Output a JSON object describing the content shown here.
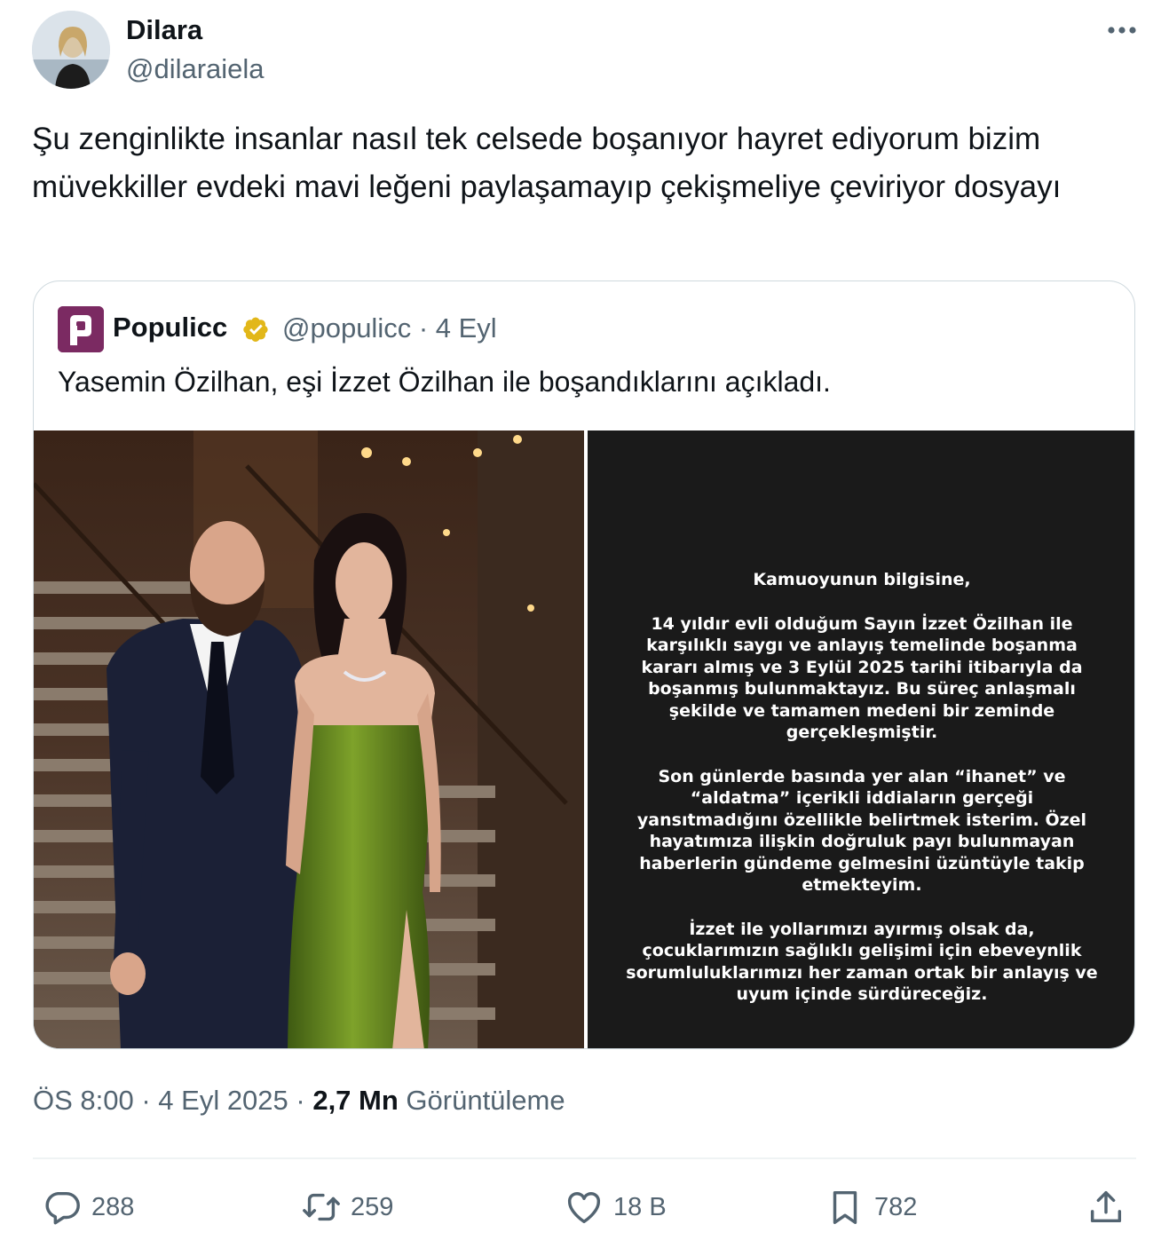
{
  "author": {
    "display_name": "Dilara",
    "handle": "@dilaraiela"
  },
  "tweet": {
    "text": "Şu zenginlikte insanlar nasıl tek celsede boşanıyor hayret ediyorum bizim müvekkiller evdeki mavi leğeni paylaşamayıp çekişmeliye çeviriyor dosyayı"
  },
  "quote": {
    "name": "Populicc",
    "handle_date": "@populicc · 4 Eyl",
    "text": "Yasemin Özilhan, eşi İzzet Özilhan ile boşandıklarını açıkladı.",
    "statement": {
      "p1": "Kamuoyunun bilgisine,",
      "p2": "14 yıldır evli olduğum Sayın İzzet Özilhan ile karşılıklı saygı ve anlayış temelinde boşanma kararı almış ve 3 Eylül 2025 tarihi itibarıyla da boşanmış bulunmaktayız. Bu süreç anlaşmalı şekilde ve tamamen medeni bir zeminde gerçekleşmiştir.",
      "p3": "Son günlerde basında yer alan “ihanet” ve “aldatma” içerikli iddiaların gerçeği yansıtmadığını özellikle belirtmek isterim. Özel hayatımıza ilişkin doğruluk payı bulunmayan haberlerin gündeme gelmesini üzüntüyle takip etmekteyim.",
      "p4": "İzzet  ile yollarımızı ayırmış olsak da, çocuklarımızın sağlıklı gelişimi için ebeveynlik sorumluluklarımızı her zaman ortak bir anlayış ve uyum içinde sürdüreceğiz."
    }
  },
  "meta": {
    "time_date": "ÖS 8:00 · 4 Eyl 2025 · ",
    "views_count": "2,7 Mn",
    "views_label": " Görüntüleme"
  },
  "actions": {
    "replies": "288",
    "retweets": "259",
    "likes": "18 B",
    "bookmarks": "782"
  },
  "icons": {
    "more": "more-dots-icon",
    "verified": "verified-badge-icon",
    "reply": "reply-bubble-icon",
    "retweet": "retweet-icon",
    "like": "heart-icon",
    "bookmark": "bookmark-icon",
    "share": "share-upload-icon"
  },
  "colors": {
    "text_primary": "#0f1419",
    "text_secondary": "#536471",
    "border": "#cfd9de",
    "verified_gold": "#e2b719",
    "populicc_brand": "#7b2a62"
  }
}
